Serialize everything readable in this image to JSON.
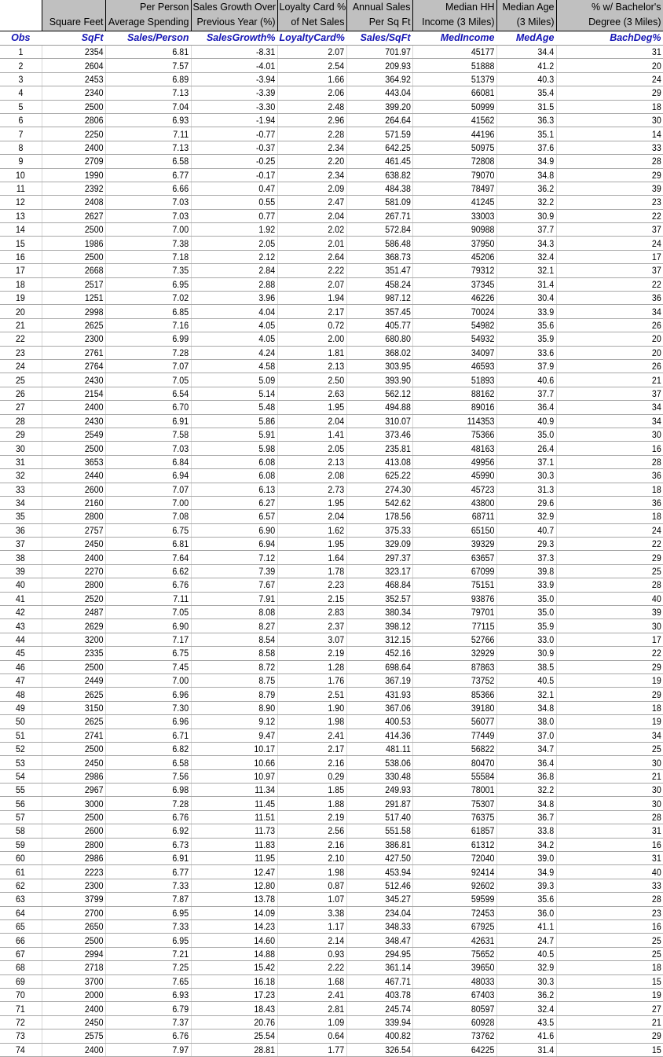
{
  "columns": [
    {
      "desc": [
        "",
        ""
      ],
      "var": "Obs"
    },
    {
      "desc": [
        "",
        "Square Feet"
      ],
      "var": "SqFt"
    },
    {
      "desc": [
        "Per Person",
        "Average Spending"
      ],
      "var": "Sales/Person"
    },
    {
      "desc": [
        "Sales Growth Over",
        "Previous Year (%)"
      ],
      "var": "SalesGrowth%"
    },
    {
      "desc": [
        "Loyalty Card %",
        "of Net Sales"
      ],
      "var": "LoyaltyCard%"
    },
    {
      "desc": [
        "Annual Sales",
        "Per Sq Ft"
      ],
      "var": "Sales/SqFt"
    },
    {
      "desc": [
        "Median HH",
        "Income (3 Miles)"
      ],
      "var": "MedIncome"
    },
    {
      "desc": [
        "Median Age",
        "(3 Miles)"
      ],
      "var": "MedAge"
    },
    {
      "desc": [
        "% w/ Bachelor's",
        "Degree (3 Miles)"
      ],
      "var": "BachDeg%"
    }
  ],
  "rows": [
    [
      "1",
      "2354",
      "6.81",
      "-8.31",
      "2.07",
      "701.97",
      "45177",
      "34.4",
      "31"
    ],
    [
      "2",
      "2604",
      "7.57",
      "-4.01",
      "2.54",
      "209.93",
      "51888",
      "41.2",
      "20"
    ],
    [
      "3",
      "2453",
      "6.89",
      "-3.94",
      "1.66",
      "364.92",
      "51379",
      "40.3",
      "24"
    ],
    [
      "4",
      "2340",
      "7.13",
      "-3.39",
      "2.06",
      "443.04",
      "66081",
      "35.4",
      "29"
    ],
    [
      "5",
      "2500",
      "7.04",
      "-3.30",
      "2.48",
      "399.20",
      "50999",
      "31.5",
      "18"
    ],
    [
      "6",
      "2806",
      "6.93",
      "-1.94",
      "2.96",
      "264.64",
      "41562",
      "36.3",
      "30"
    ],
    [
      "7",
      "2250",
      "7.11",
      "-0.77",
      "2.28",
      "571.59",
      "44196",
      "35.1",
      "14"
    ],
    [
      "8",
      "2400",
      "7.13",
      "-0.37",
      "2.34",
      "642.25",
      "50975",
      "37.6",
      "33"
    ],
    [
      "9",
      "2709",
      "6.58",
      "-0.25",
      "2.20",
      "461.45",
      "72808",
      "34.9",
      "28"
    ],
    [
      "10",
      "1990",
      "6.77",
      "-0.17",
      "2.34",
      "638.82",
      "79070",
      "34.8",
      "29"
    ],
    [
      "11",
      "2392",
      "6.66",
      "0.47",
      "2.09",
      "484.38",
      "78497",
      "36.2",
      "39"
    ],
    [
      "12",
      "2408",
      "7.03",
      "0.55",
      "2.47",
      "581.09",
      "41245",
      "32.2",
      "23"
    ],
    [
      "13",
      "2627",
      "7.03",
      "0.77",
      "2.04",
      "267.71",
      "33003",
      "30.9",
      "22"
    ],
    [
      "14",
      "2500",
      "7.00",
      "1.92",
      "2.02",
      "572.84",
      "90988",
      "37.7",
      "37"
    ],
    [
      "15",
      "1986",
      "7.38",
      "2.05",
      "2.01",
      "586.48",
      "37950",
      "34.3",
      "24"
    ],
    [
      "16",
      "2500",
      "7.18",
      "2.12",
      "2.64",
      "368.73",
      "45206",
      "32.4",
      "17"
    ],
    [
      "17",
      "2668",
      "7.35",
      "2.84",
      "2.22",
      "351.47",
      "79312",
      "32.1",
      "37"
    ],
    [
      "18",
      "2517",
      "6.95",
      "2.88",
      "2.07",
      "458.24",
      "37345",
      "31.4",
      "22"
    ],
    [
      "19",
      "1251",
      "7.02",
      "3.96",
      "1.94",
      "987.12",
      "46226",
      "30.4",
      "36"
    ],
    [
      "20",
      "2998",
      "6.85",
      "4.04",
      "2.17",
      "357.45",
      "70024",
      "33.9",
      "34"
    ],
    [
      "21",
      "2625",
      "7.16",
      "4.05",
      "0.72",
      "405.77",
      "54982",
      "35.6",
      "26"
    ],
    [
      "22",
      "2300",
      "6.99",
      "4.05",
      "2.00",
      "680.80",
      "54932",
      "35.9",
      "20"
    ],
    [
      "23",
      "2761",
      "7.28",
      "4.24",
      "1.81",
      "368.02",
      "34097",
      "33.6",
      "20"
    ],
    [
      "24",
      "2764",
      "7.07",
      "4.58",
      "2.13",
      "303.95",
      "46593",
      "37.9",
      "26"
    ],
    [
      "25",
      "2430",
      "7.05",
      "5.09",
      "2.50",
      "393.90",
      "51893",
      "40.6",
      "21"
    ],
    [
      "26",
      "2154",
      "6.54",
      "5.14",
      "2.63",
      "562.12",
      "88162",
      "37.7",
      "37"
    ],
    [
      "27",
      "2400",
      "6.70",
      "5.48",
      "1.95",
      "494.88",
      "89016",
      "36.4",
      "34"
    ],
    [
      "28",
      "2430",
      "6.91",
      "5.86",
      "2.04",
      "310.07",
      "114353",
      "40.9",
      "34"
    ],
    [
      "29",
      "2549",
      "7.58",
      "5.91",
      "1.41",
      "373.46",
      "75366",
      "35.0",
      "30"
    ],
    [
      "30",
      "2500",
      "7.03",
      "5.98",
      "2.05",
      "235.81",
      "48163",
      "26.4",
      "16"
    ],
    [
      "31",
      "3653",
      "6.84",
      "6.08",
      "2.13",
      "413.08",
      "49956",
      "37.1",
      "28"
    ],
    [
      "32",
      "2440",
      "6.94",
      "6.08",
      "2.08",
      "625.22",
      "45990",
      "30.3",
      "36"
    ],
    [
      "33",
      "2600",
      "7.07",
      "6.13",
      "2.73",
      "274.30",
      "45723",
      "31.3",
      "18"
    ],
    [
      "34",
      "2160",
      "7.00",
      "6.27",
      "1.95",
      "542.62",
      "43800",
      "29.6",
      "36"
    ],
    [
      "35",
      "2800",
      "7.08",
      "6.57",
      "2.04",
      "178.56",
      "68711",
      "32.9",
      "18"
    ],
    [
      "36",
      "2757",
      "6.75",
      "6.90",
      "1.62",
      "375.33",
      "65150",
      "40.7",
      "24"
    ],
    [
      "37",
      "2450",
      "6.81",
      "6.94",
      "1.95",
      "329.09",
      "39329",
      "29.3",
      "22"
    ],
    [
      "38",
      "2400",
      "7.64",
      "7.12",
      "1.64",
      "297.37",
      "63657",
      "37.3",
      "29"
    ],
    [
      "39",
      "2270",
      "6.62",
      "7.39",
      "1.78",
      "323.17",
      "67099",
      "39.8",
      "25"
    ],
    [
      "40",
      "2800",
      "6.76",
      "7.67",
      "2.23",
      "468.84",
      "75151",
      "33.9",
      "28"
    ],
    [
      "41",
      "2520",
      "7.11",
      "7.91",
      "2.15",
      "352.57",
      "93876",
      "35.0",
      "40"
    ],
    [
      "42",
      "2487",
      "7.05",
      "8.08",
      "2.83",
      "380.34",
      "79701",
      "35.0",
      "39"
    ],
    [
      "43",
      "2629",
      "6.90",
      "8.27",
      "2.37",
      "398.12",
      "77115",
      "35.9",
      "30"
    ],
    [
      "44",
      "3200",
      "7.17",
      "8.54",
      "3.07",
      "312.15",
      "52766",
      "33.0",
      "17"
    ],
    [
      "45",
      "2335",
      "6.75",
      "8.58",
      "2.19",
      "452.16",
      "32929",
      "30.9",
      "22"
    ],
    [
      "46",
      "2500",
      "7.45",
      "8.72",
      "1.28",
      "698.64",
      "87863",
      "38.5",
      "29"
    ],
    [
      "47",
      "2449",
      "7.00",
      "8.75",
      "1.76",
      "367.19",
      "73752",
      "40.5",
      "19"
    ],
    [
      "48",
      "2625",
      "6.96",
      "8.79",
      "2.51",
      "431.93",
      "85366",
      "32.1",
      "29"
    ],
    [
      "49",
      "3150",
      "7.30",
      "8.90",
      "1.90",
      "367.06",
      "39180",
      "34.8",
      "18"
    ],
    [
      "50",
      "2625",
      "6.96",
      "9.12",
      "1.98",
      "400.53",
      "56077",
      "38.0",
      "19"
    ],
    [
      "51",
      "2741",
      "6.71",
      "9.47",
      "2.41",
      "414.36",
      "77449",
      "37.0",
      "34"
    ],
    [
      "52",
      "2500",
      "6.82",
      "10.17",
      "2.17",
      "481.11",
      "56822",
      "34.7",
      "25"
    ],
    [
      "53",
      "2450",
      "6.58",
      "10.66",
      "2.16",
      "538.06",
      "80470",
      "36.4",
      "30"
    ],
    [
      "54",
      "2986",
      "7.56",
      "10.97",
      "0.29",
      "330.48",
      "55584",
      "36.8",
      "21"
    ],
    [
      "55",
      "2967",
      "6.98",
      "11.34",
      "1.85",
      "249.93",
      "78001",
      "32.2",
      "30"
    ],
    [
      "56",
      "3000",
      "7.28",
      "11.45",
      "1.88",
      "291.87",
      "75307",
      "34.8",
      "30"
    ],
    [
      "57",
      "2500",
      "6.76",
      "11.51",
      "2.19",
      "517.40",
      "76375",
      "36.7",
      "28"
    ],
    [
      "58",
      "2600",
      "6.92",
      "11.73",
      "2.56",
      "551.58",
      "61857",
      "33.8",
      "31"
    ],
    [
      "59",
      "2800",
      "6.73",
      "11.83",
      "2.16",
      "386.81",
      "61312",
      "34.2",
      "16"
    ],
    [
      "60",
      "2986",
      "6.91",
      "11.95",
      "2.10",
      "427.50",
      "72040",
      "39.0",
      "31"
    ],
    [
      "61",
      "2223",
      "6.77",
      "12.47",
      "1.98",
      "453.94",
      "92414",
      "34.9",
      "40"
    ],
    [
      "62",
      "2300",
      "7.33",
      "12.80",
      "0.87",
      "512.46",
      "92602",
      "39.3",
      "33"
    ],
    [
      "63",
      "3799",
      "7.87",
      "13.78",
      "1.07",
      "345.27",
      "59599",
      "35.6",
      "28"
    ],
    [
      "64",
      "2700",
      "6.95",
      "14.09",
      "3.38",
      "234.04",
      "72453",
      "36.0",
      "23"
    ],
    [
      "65",
      "2650",
      "7.33",
      "14.23",
      "1.17",
      "348.33",
      "67925",
      "41.1",
      "16"
    ],
    [
      "66",
      "2500",
      "6.95",
      "14.60",
      "2.14",
      "348.47",
      "42631",
      "24.7",
      "25"
    ],
    [
      "67",
      "2994",
      "7.21",
      "14.88",
      "0.93",
      "294.95",
      "75652",
      "40.5",
      "25"
    ],
    [
      "68",
      "2718",
      "7.25",
      "15.42",
      "2.22",
      "361.14",
      "39650",
      "32.9",
      "18"
    ],
    [
      "69",
      "3700",
      "7.65",
      "16.18",
      "1.68",
      "467.71",
      "48033",
      "30.3",
      "15"
    ],
    [
      "70",
      "2000",
      "6.93",
      "17.23",
      "2.41",
      "403.78",
      "67403",
      "36.2",
      "19"
    ],
    [
      "71",
      "2400",
      "6.79",
      "18.43",
      "2.81",
      "245.74",
      "80597",
      "32.4",
      "27"
    ],
    [
      "72",
      "2450",
      "7.37",
      "20.76",
      "1.09",
      "339.94",
      "60928",
      "43.5",
      "21"
    ],
    [
      "73",
      "2575",
      "6.76",
      "25.54",
      "0.64",
      "400.82",
      "73762",
      "41.6",
      "29"
    ],
    [
      "74",
      "2400",
      "7.97",
      "28.81",
      "1.77",
      "326.54",
      "64225",
      "31.4",
      "15"
    ]
  ],
  "colors": {
    "header_fill": "#c0c0c0",
    "variable_name_text": "#1515b4",
    "gridline": "#a8a8a8"
  }
}
